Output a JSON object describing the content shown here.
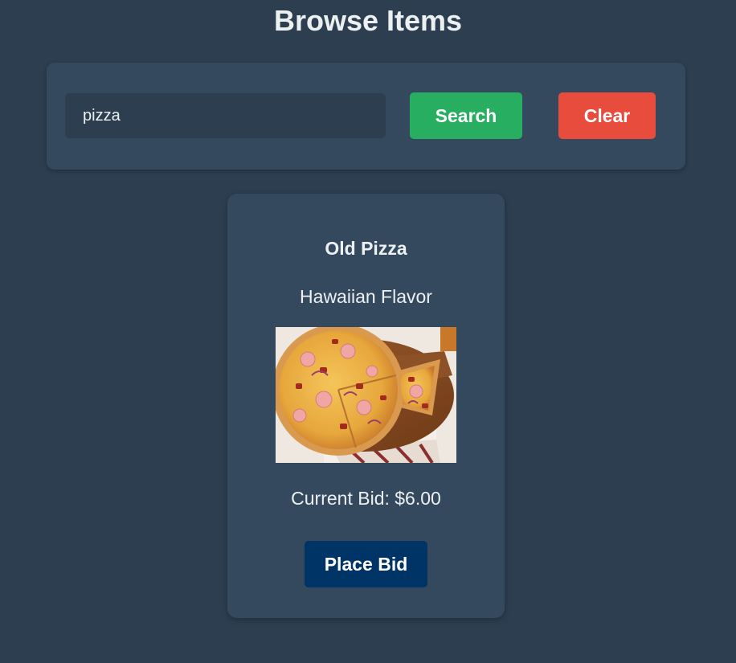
{
  "page": {
    "title": "Browse Items"
  },
  "search": {
    "value": "pizza",
    "search_label": "Search",
    "clear_label": "Clear"
  },
  "items": [
    {
      "name": "Old Pizza",
      "description": "Hawaiian Flavor",
      "image": "hawaiian-pizza-photo",
      "current_bid": "Current Bid: $6.00",
      "bid_label": "Place Bid"
    }
  ],
  "colors": {
    "background": "#2c3e50",
    "panel": "#34495e",
    "search_button": "#27ae60",
    "clear_button": "#e74c3c",
    "bid_button": "#003366",
    "text": "#ecf0f1"
  }
}
